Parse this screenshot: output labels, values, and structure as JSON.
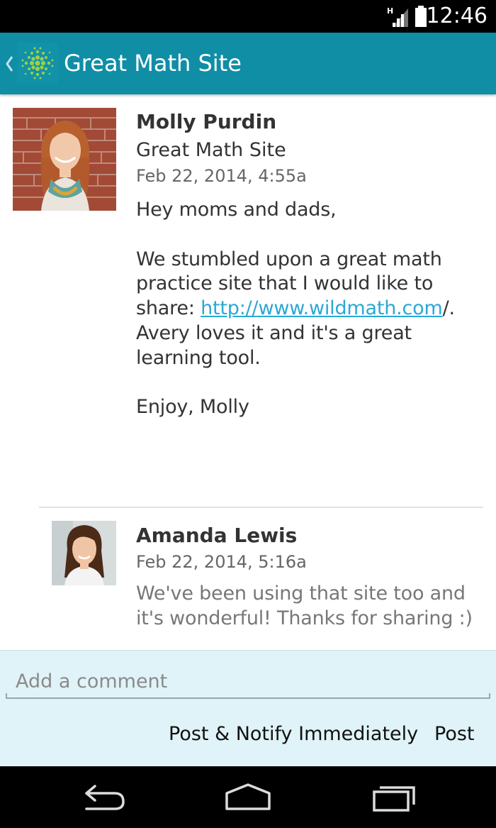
{
  "status_bar": {
    "time": "12:46",
    "network_label": "H",
    "icons": [
      "signal-icon",
      "battery-icon"
    ]
  },
  "app_bar": {
    "title": "Great Math Site",
    "back_icon": "chevron-left-icon",
    "logo_icon": "dot-cluster-logo"
  },
  "post": {
    "author": "Molly Purdin",
    "group": "Great Math Site",
    "timestamp": "Feb 22, 2014, 4:55a",
    "greeting": "Hey moms and dads,",
    "body_before_link": "We stumbled upon a great math practice site that I would like to share: ",
    "link": "http://www.wildmath.com",
    "body_after_link": "/. Avery loves it and it's a great learning tool.",
    "signoff": "Enjoy, Molly"
  },
  "comments": [
    {
      "author": "Amanda Lewis",
      "timestamp": "Feb 22, 2014, 5:16a",
      "text": "We've been using that site too and it's wonderful! Thanks for sharing :)"
    }
  ],
  "composer": {
    "placeholder": "Add a comment",
    "value": "",
    "notify_button": "Post & Notify Immediately",
    "post_button": "Post"
  },
  "nav_bar": {
    "icons": [
      "back-nav-icon",
      "home-nav-icon",
      "recent-apps-icon"
    ]
  },
  "colors": {
    "app_bar": "#0f8ea6",
    "link": "#2aa8d6",
    "composer_bg": "#dff3f8",
    "logo_green": "#9cd14a"
  }
}
